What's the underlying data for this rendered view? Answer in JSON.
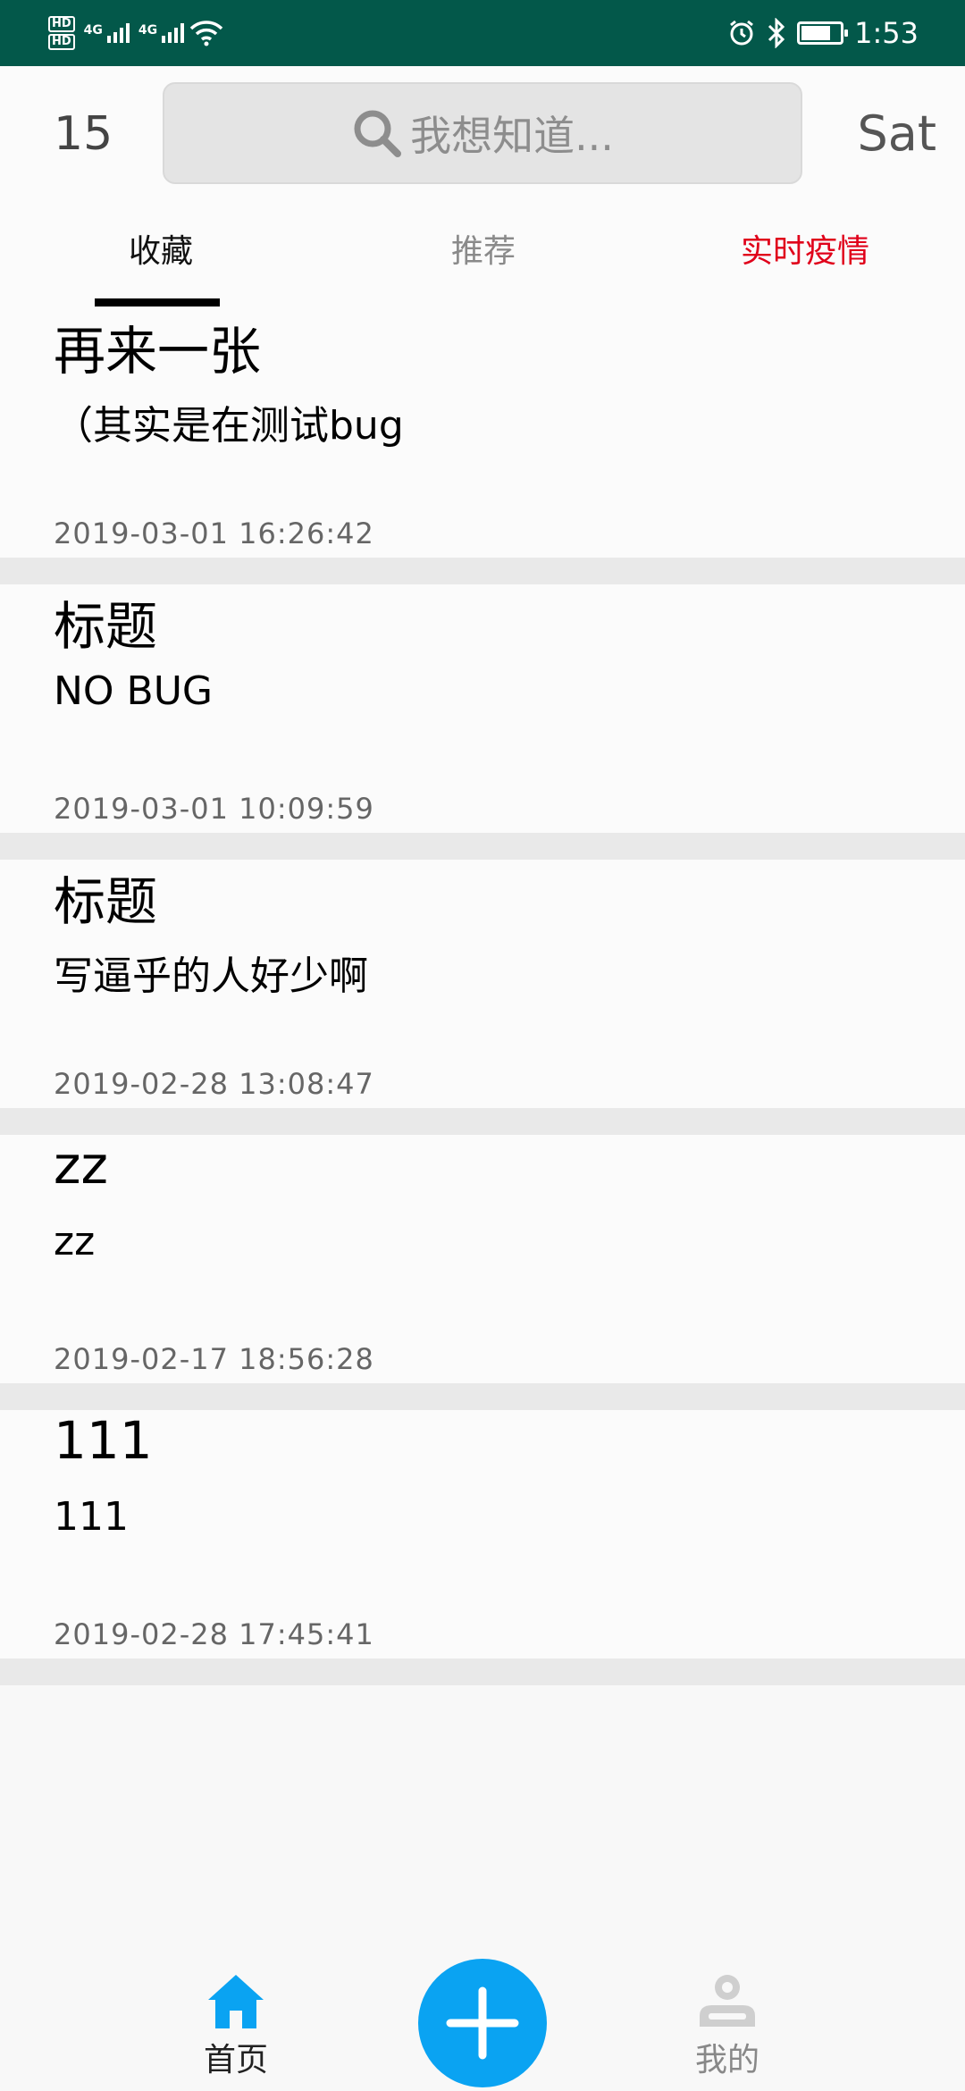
{
  "status_bar": {
    "hd1": "HD",
    "hd2": "HD",
    "net1": "4G",
    "net2": "4G",
    "time": "1:53"
  },
  "header": {
    "day_number": "15",
    "search_placeholder": "我想知道...",
    "day_name": "Sat"
  },
  "tabs": [
    {
      "label": "收藏"
    },
    {
      "label": "推荐"
    },
    {
      "label": "实时疫情"
    }
  ],
  "items": [
    {
      "title": "再来一张",
      "body": "（其实是在测试bug",
      "date": "2019-03-01 16:26:42"
    },
    {
      "title": "标题",
      "body": "NO BUG",
      "date": "2019-03-01 10:09:59"
    },
    {
      "title": "标题",
      "body": "写逼乎的人好少啊",
      "date": "2019-02-28 13:08:47"
    },
    {
      "title": "zz",
      "body": "zz",
      "date": "2019-02-17 18:56:28"
    },
    {
      "title": "111",
      "body": "111",
      "date": "2019-02-28 17:45:41"
    }
  ],
  "bottom_nav": {
    "home_label": "首页",
    "me_label": "我的"
  },
  "colors": {
    "status_bar": "#03584a",
    "accent_blue": "#0aa3f2",
    "tab_alert_red": "#e0001a"
  }
}
